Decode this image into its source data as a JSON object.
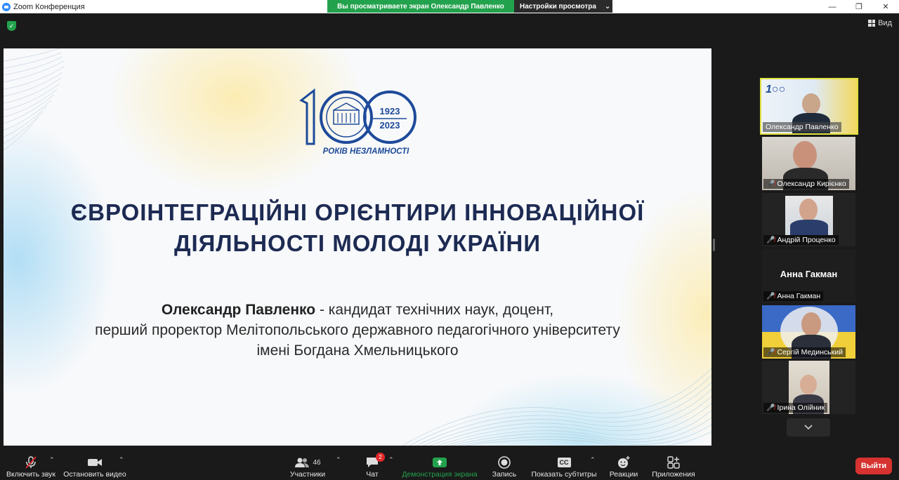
{
  "window": {
    "title": "Zoom Конференция",
    "minimize": "—",
    "restore": "❐",
    "close": "✕"
  },
  "share_banner": {
    "viewing": "Вы просматриваете экран Олександр Павленко",
    "view_options": "Настройки просмотра",
    "view_options_caret": "⌄"
  },
  "view_button": {
    "label": "Вид"
  },
  "slide": {
    "logo_text_years": "1923",
    "logo_text_years2": "2023",
    "logo_caption": "РОКІВ НЕЗЛАМНОСТІ",
    "title_line1": "ЄВРОІНТЕГРАЦІЙНІ ОРІЄНТИРИ ІННОВАЦІЙНОЇ",
    "title_line2": "ДІЯЛЬНОСТІ МОЛОДІ УКРАЇНИ",
    "speaker_name": "Олександр Павленко",
    "speaker_line1_rest": " - кандидат технічних наук, доцент,",
    "speaker_line2": "перший проректор Мелітопольського державного педагогічного університету",
    "speaker_line3": "імені Богдана Хмельницького"
  },
  "participants": [
    {
      "name": "Олександр Павленко",
      "muted": false,
      "active": true
    },
    {
      "name": "Олександр Кирієнко",
      "muted": true,
      "active": false
    },
    {
      "name": "Андрій Проценко",
      "muted": true,
      "active": false
    },
    {
      "name": "Анна Гакман",
      "muted": true,
      "active": false,
      "no_video": true,
      "display": "Анна Гакман"
    },
    {
      "name": "Сергій Мединський",
      "muted": true,
      "active": false
    },
    {
      "name": "Ірина Олійник",
      "muted": true,
      "active": false
    }
  ],
  "more_icon": "chevron-down-icon",
  "toolbar": {
    "audio": "Включить звук",
    "video": "Остановить видео",
    "participants": "Участники",
    "participants_count": "46",
    "chat": "Чат",
    "chat_badge": "2",
    "share": "Демонстрация экрана",
    "record": "Запись",
    "captions": "Показать субтитры",
    "captions_icon_text": "CC",
    "reactions": "Реакции",
    "apps": "Приложения",
    "leave": "Выйти",
    "caret": "⌃"
  },
  "colors": {
    "share_green": "#23a24d",
    "leave_red": "#d6322f",
    "slide_navy": "#1d2b53",
    "active_border": "#e0e040"
  }
}
